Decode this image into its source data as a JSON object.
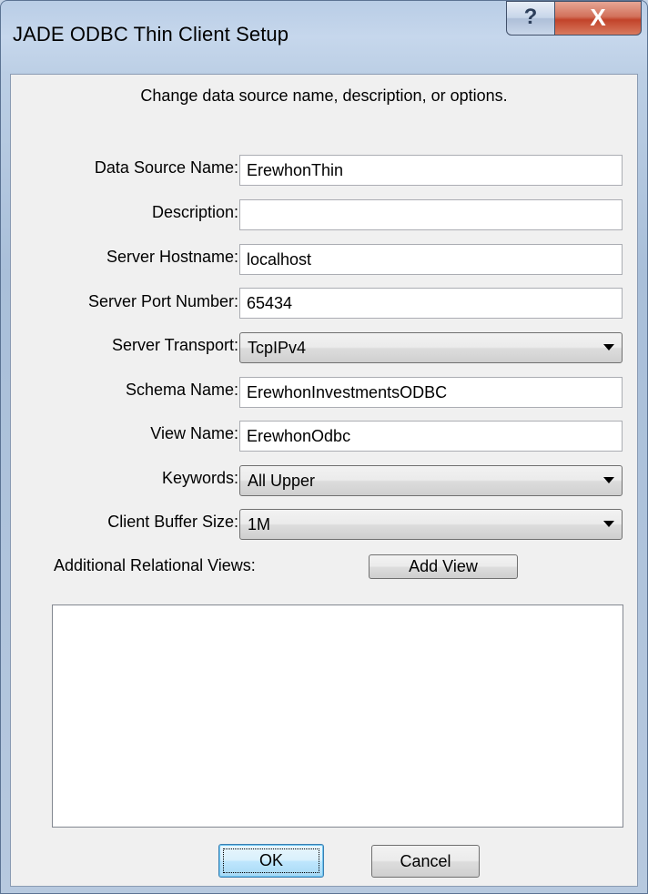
{
  "window": {
    "title": "JADE ODBC Thin Client Setup",
    "help_glyph": "?",
    "close_glyph": "X"
  },
  "dialog": {
    "heading": "Change data source name, description, or options.",
    "fields": {
      "data_source_name": {
        "label": "Data Source Name:",
        "value": "ErewhonThin"
      },
      "description": {
        "label": "Description:",
        "value": ""
      },
      "server_hostname": {
        "label": "Server Hostname:",
        "value": "localhost"
      },
      "server_port": {
        "label": "Server Port Number:",
        "value": "65434"
      },
      "server_transport": {
        "label": "Server Transport:",
        "value": "TcpIPv4"
      },
      "schema_name": {
        "label": "Schema Name:",
        "value": "ErewhonInvestmentsODBC"
      },
      "view_name": {
        "label": "View Name:",
        "value": "ErewhonOdbc"
      },
      "keywords": {
        "label": "Keywords:",
        "value": "All Upper"
      },
      "client_buffer_size": {
        "label": "Client Buffer Size:",
        "value": "1M"
      }
    },
    "additional_views_label": "Additional Relational Views:",
    "add_view_label": "Add View",
    "additional_views": [],
    "ok_label": "OK",
    "cancel_label": "Cancel"
  }
}
